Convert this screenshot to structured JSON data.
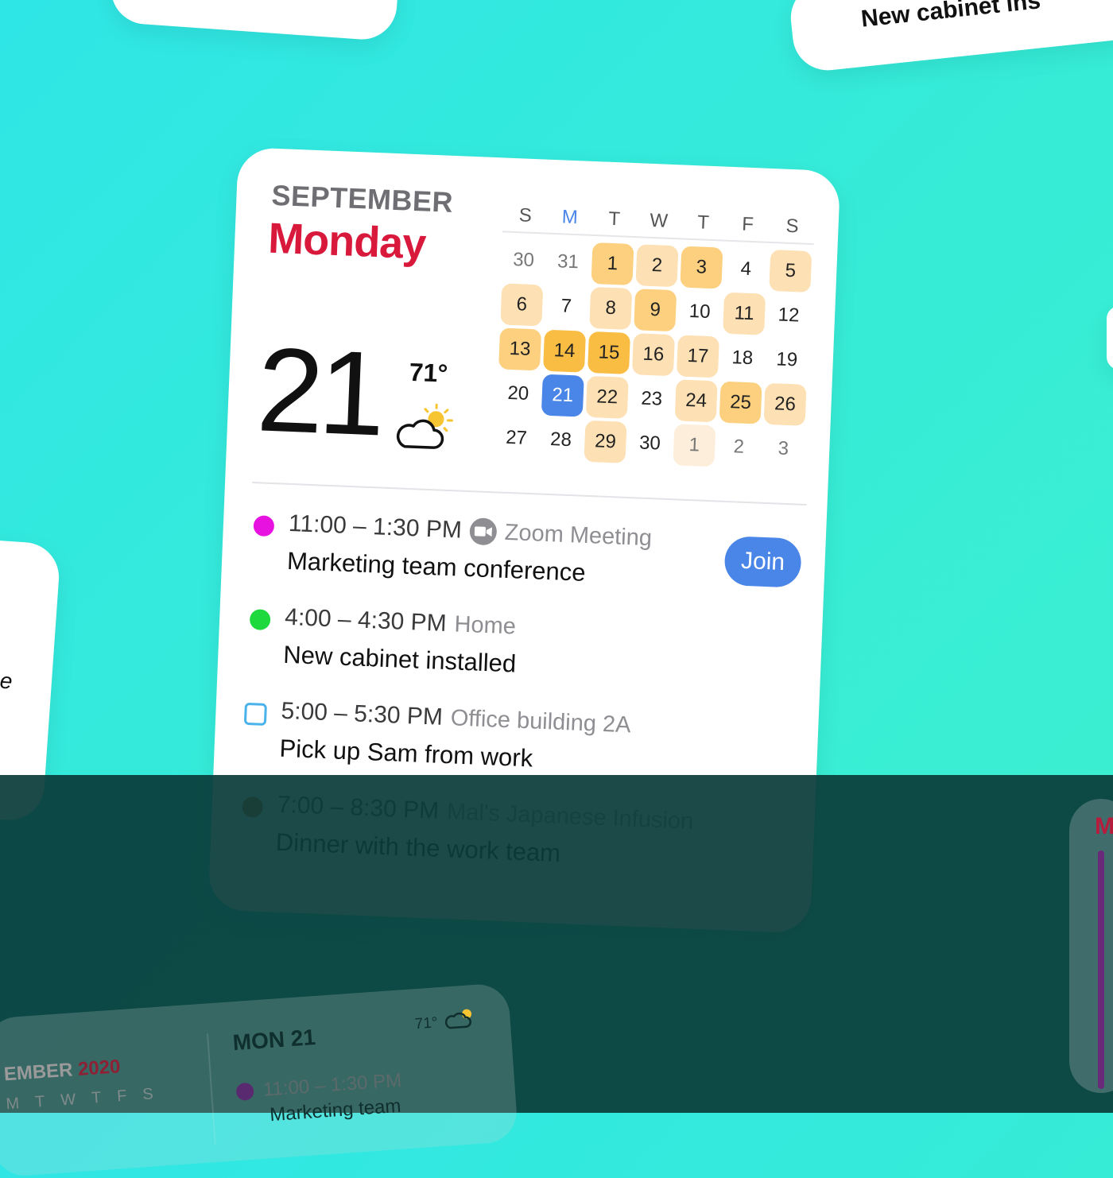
{
  "background_cards": {
    "top_right_text": "New cabinet ins",
    "left_fragment": "e",
    "right_fragment": "M"
  },
  "widget": {
    "month": "SEPTEMBER",
    "weekday": "Monday",
    "day_number": "21",
    "temperature": "71°",
    "weather_icon": "partly-cloudy-icon",
    "calendar": {
      "weekday_headers": [
        "S",
        "M",
        "T",
        "W",
        "T",
        "F",
        "S"
      ],
      "current_weekday_index": 1,
      "weeks": [
        [
          {
            "d": "30",
            "dim": true
          },
          {
            "d": "31",
            "dim": true
          },
          {
            "d": "1",
            "h": 2
          },
          {
            "d": "2",
            "h": 1
          },
          {
            "d": "3",
            "h": 2
          },
          {
            "d": "4"
          },
          {
            "d": "5",
            "h": 1
          }
        ],
        [
          {
            "d": "6",
            "h": 1
          },
          {
            "d": "7"
          },
          {
            "d": "8",
            "h": 1
          },
          {
            "d": "9",
            "h": 2
          },
          {
            "d": "10"
          },
          {
            "d": "11",
            "h": 1
          },
          {
            "d": "12"
          }
        ],
        [
          {
            "d": "13",
            "h": 2
          },
          {
            "d": "14",
            "h": 3
          },
          {
            "d": "15",
            "h": 3
          },
          {
            "d": "16",
            "h": 1
          },
          {
            "d": "17",
            "h": 1
          },
          {
            "d": "18"
          },
          {
            "d": "19"
          }
        ],
        [
          {
            "d": "20"
          },
          {
            "d": "21",
            "today": true
          },
          {
            "d": "22",
            "h": 1
          },
          {
            "d": "23"
          },
          {
            "d": "24",
            "h": 1
          },
          {
            "d": "25",
            "h": 2
          },
          {
            "d": "26",
            "h": 1
          }
        ],
        [
          {
            "d": "27"
          },
          {
            "d": "28"
          },
          {
            "d": "29",
            "h": 1
          },
          {
            "d": "30"
          },
          {
            "d": "1",
            "h": 0,
            "dim": true
          },
          {
            "d": "2",
            "dim": true
          },
          {
            "d": "3",
            "dim": true
          }
        ]
      ]
    },
    "events": [
      {
        "time": "11:00 – 1:30 PM",
        "location": "Zoom Meeting",
        "title": "Marketing team conference",
        "color": "#e812e0",
        "marker": "dot",
        "zoom": true,
        "action": "Join"
      },
      {
        "time": "4:00 – 4:30 PM",
        "location": "Home",
        "title": "New cabinet installed",
        "color": "#1ed93e",
        "marker": "dot"
      },
      {
        "time": "5:00 – 5:30 PM",
        "location": "Office building 2A",
        "title": "Pick up Sam from work",
        "color": "#4ab2ea",
        "marker": "checkbox"
      },
      {
        "time": "7:00 – 8:30 PM",
        "location": "Mal's Japanese Infusion",
        "title": "Dinner with the work team",
        "color": "#d9481a",
        "marker": "dot"
      }
    ]
  },
  "bottom_card": {
    "month": "EMBER",
    "year": "2020",
    "weekdays": [
      "M",
      "T",
      "W",
      "T",
      "F",
      "S"
    ],
    "date_heading": "MON 21",
    "temperature": "71°",
    "event_time": "11:00 – 1:30 PM",
    "event_title": "Marketing team"
  },
  "colors": {
    "accent_blue": "#4a86e8",
    "weekday_red": "#d9193b"
  }
}
